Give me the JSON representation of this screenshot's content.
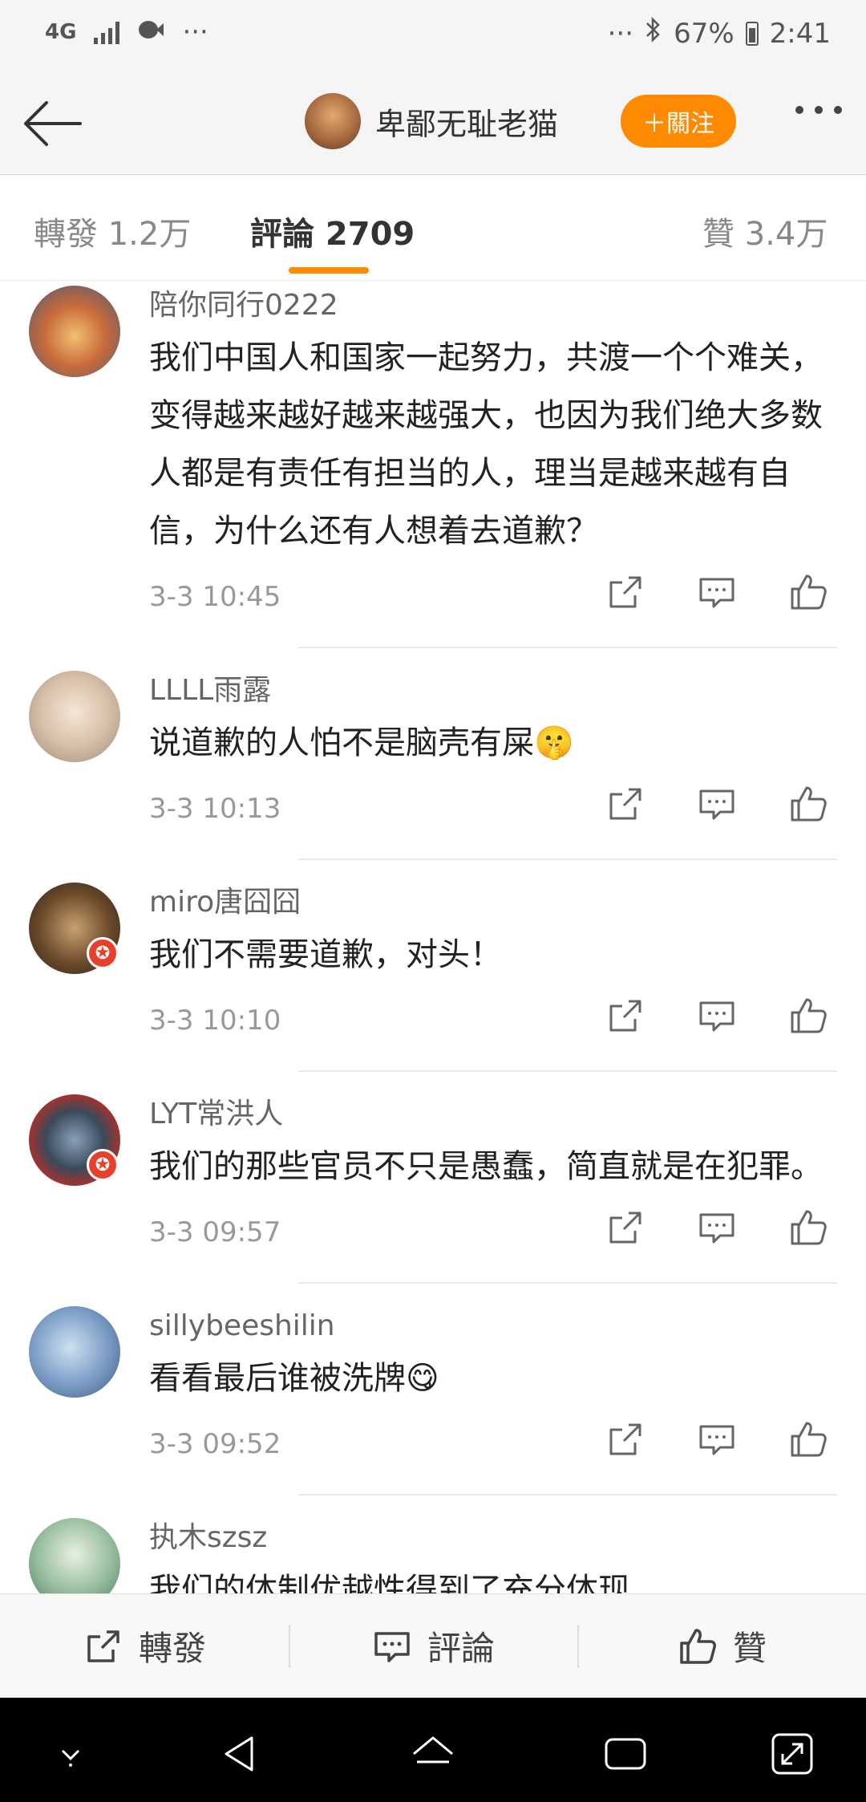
{
  "status_bar": {
    "network": "4G",
    "dots": "···",
    "dots_right": "···",
    "battery": "67%",
    "time": "2:41"
  },
  "header": {
    "username": "卑鄙无耻老猫",
    "follow_label": "＋關注"
  },
  "tabs": [
    {
      "label": "轉發 1.2万"
    },
    {
      "label": "評論 2709"
    },
    {
      "label": "贊 3.4万"
    }
  ],
  "comments": [
    {
      "name": "陪你同行0222",
      "text": "我们中国人和国家一起努力，共渡一个个难关，变得越来越好越来越强大，也因为我们绝大多数人都是有责任有担当的人，理当是越来越有自信，为什么还有人想着去道歉？",
      "time": "3-3 10:45"
    },
    {
      "name": "LLLL雨露",
      "text": "说道歉的人怕不是脑壳有屎🤫",
      "time": "3-3 10:13"
    },
    {
      "name": "miro唐囧囧",
      "text": "我们不需要道歉，对头！",
      "time": "3-3 10:10"
    },
    {
      "name": "LYT常洪人",
      "text": "我们的那些官员不只是愚蠢，简直就是在犯罪。",
      "time": "3-3 09:57"
    },
    {
      "name": "sillybeeshilin",
      "text": "看看最后谁被洗牌😋",
      "time": "3-3 09:52"
    },
    {
      "name": "执木szsz",
      "text": "我们的体制优越性得到了充分体现",
      "time": ""
    }
  ],
  "bottom_bar": {
    "repost_label": "轉發",
    "comment_label": "評論",
    "like_label": "贊"
  },
  "colors": {
    "accent": "#ff8a00",
    "badge": "#e8412b"
  }
}
